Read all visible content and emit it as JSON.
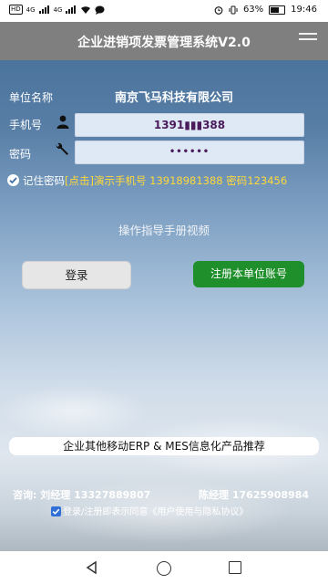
{
  "status_bar": {
    "left_badge": "HD",
    "net_1": "4G",
    "net_2": "4G",
    "battery": "63%",
    "time": "19:46"
  },
  "header": {
    "title": "企业进销项发票管理系统V2.0"
  },
  "form": {
    "company_label": "单位名称",
    "company_value": "南京飞马科技有限公司",
    "phone_label": "手机号",
    "phone_value": "1391▮▮▮388",
    "password_label": "密码",
    "password_value": "••••••"
  },
  "remember": {
    "label": "记住密码",
    "hint": "[点击]演示手机号 13918981388 密码123456"
  },
  "guide_link": "操作指导手册视频",
  "buttons": {
    "login": "登录",
    "register": "注册本单位账号"
  },
  "promo": "企业其他移动ERP & MES信息化产品推荐",
  "consult": {
    "prefix": "咨询:",
    "contact1": "刘经理 13327889807",
    "contact2": "陈经理 17625908984"
  },
  "agreement": "登录/注册即表示同意《用户使用与隐私协议》",
  "icons": {
    "person": "person-icon",
    "wrench": "wrench-icon",
    "menu": "menu-icon"
  },
  "colors": {
    "title_bar": "#7f7f7f",
    "register_button": "#1e8f2a",
    "hint_yellow": "#ffd83a",
    "input_bg": "#dfe9f6"
  }
}
